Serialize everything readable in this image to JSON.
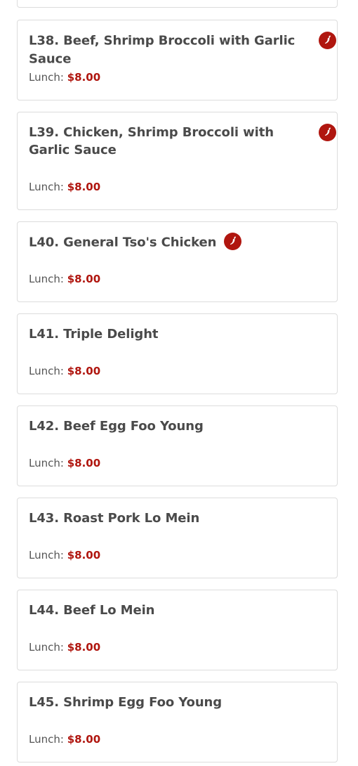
{
  "menu": {
    "items": [
      {
        "code": "L38.",
        "name": "Beef, Shrimp Broccoli with Garlic Sauce",
        "spicy": true,
        "price_label": "Lunch:",
        "price": "$8.00"
      },
      {
        "code": "L39.",
        "name": "Chicken, Shrimp Broccoli with Garlic Sauce",
        "spicy": true,
        "price_label": "Lunch:",
        "price": "$8.00"
      },
      {
        "code": "L40.",
        "name": "General Tso's Chicken",
        "spicy": true,
        "price_label": "Lunch:",
        "price": "$8.00"
      },
      {
        "code": "L41.",
        "name": "Triple Delight",
        "spicy": false,
        "price_label": "Lunch:",
        "price": "$8.00"
      },
      {
        "code": "L42.",
        "name": "Beef Egg Foo Young",
        "spicy": false,
        "price_label": "Lunch:",
        "price": "$8.00"
      },
      {
        "code": "L43.",
        "name": "Roast Pork Lo Mein",
        "spicy": false,
        "price_label": "Lunch:",
        "price": "$8.00"
      },
      {
        "code": "L44.",
        "name": "Beef Lo Mein",
        "spicy": false,
        "price_label": "Lunch:",
        "price": "$8.00"
      },
      {
        "code": "L45.",
        "name": "Shrimp Egg Foo Young",
        "spicy": false,
        "price_label": "Lunch:",
        "price": "$8.00"
      }
    ]
  },
  "colors": {
    "price": "#b0160f",
    "spicy_icon": "#b0160f",
    "title": "#4a4a4a",
    "border": "#dcdcdc"
  },
  "icons": {
    "spicy": "chili-pepper-icon"
  }
}
